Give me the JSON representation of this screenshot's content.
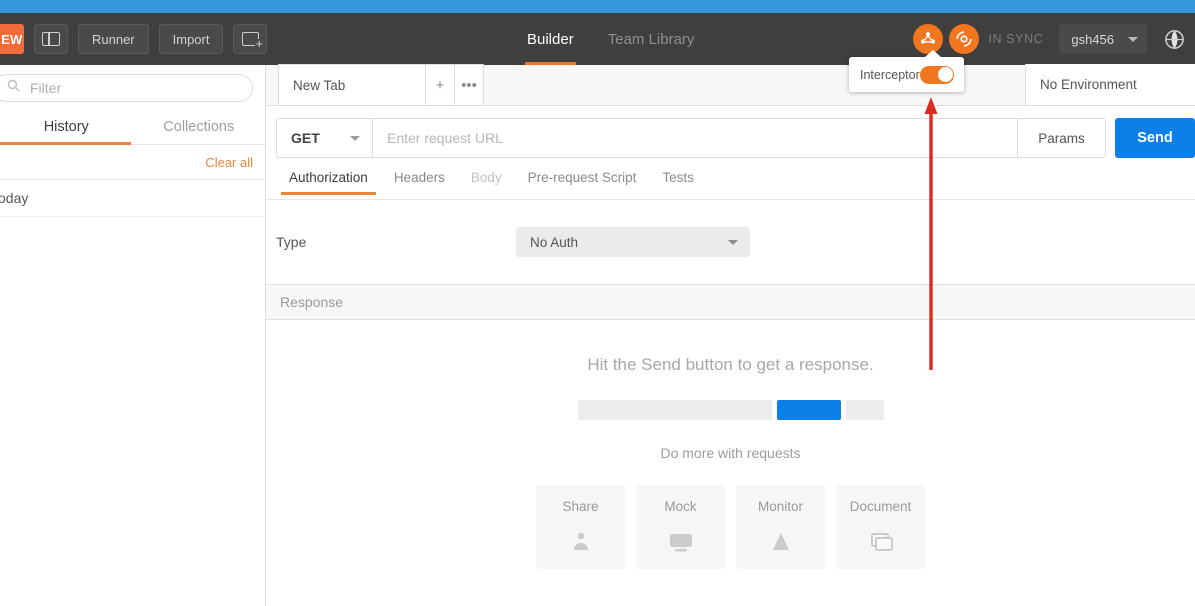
{
  "window": {
    "accent_orange": "#f1761f",
    "accent_blue": "#0d7fe8",
    "toolbar_bg": "#3f3f3f",
    "strip_blue": "#3498db",
    "annotation_red": "#d92b20"
  },
  "toolbar": {
    "new_label": "NEW",
    "sidebar_toggle_name": "sidebar-toggle",
    "runner_label": "Runner",
    "import_label": "Import",
    "new_window_label": "",
    "nav": [
      {
        "label": "Builder",
        "active": true
      },
      {
        "label": "Team Library",
        "active": false
      }
    ],
    "sync_status": "IN SYNC",
    "user_label": "gsh456",
    "globe_icon": "globe-icon",
    "sync_icon": "sync-satellite-icon",
    "team_icon": "team-orange-icon"
  },
  "interceptor": {
    "label": "Interceptor",
    "toggle_on": true
  },
  "sidebar": {
    "filter_placeholder": "Filter",
    "search_icon": "search-icon",
    "tabs": [
      {
        "label": "History",
        "active": true
      },
      {
        "label": "Collections",
        "active": false
      }
    ],
    "clear_all_label": "Clear all",
    "today_label": "Today"
  },
  "tabbar": {
    "tab_label": "New Tab",
    "add_label": "+",
    "more_label": "•••",
    "environment_label": "No Environment"
  },
  "request": {
    "method": "GET",
    "url_value": "",
    "url_placeholder": "Enter request URL",
    "params_label": "Params",
    "send_label": "Send",
    "tabs": [
      {
        "label": "Authorization",
        "active": true,
        "dim": false
      },
      {
        "label": "Headers",
        "active": false,
        "dim": false
      },
      {
        "label": "Body",
        "active": false,
        "dim": true
      },
      {
        "label": "Pre-request Script",
        "active": false,
        "dim": false
      },
      {
        "label": "Tests",
        "active": false,
        "dim": false
      }
    ],
    "auth": {
      "type_label": "Type",
      "type_value": "No Auth"
    }
  },
  "response": {
    "header_label": "Response",
    "empty_title": "Hit the Send button to get a response.",
    "empty_subtitle": "Do more with requests",
    "cards": [
      {
        "label": "Share",
        "icon": "share-icon"
      },
      {
        "label": "Mock",
        "icon": "mock-server-icon"
      },
      {
        "label": "Monitor",
        "icon": "monitor-icon"
      },
      {
        "label": "Document",
        "icon": "document-icon"
      }
    ]
  }
}
